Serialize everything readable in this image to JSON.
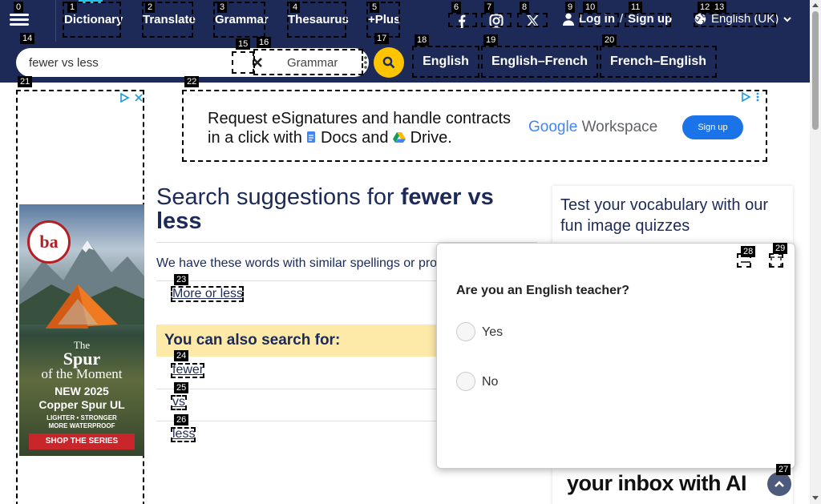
{
  "nav": {
    "items": [
      "Dictionary",
      "Translate",
      "Grammar",
      "Thesaurus",
      "+Plus"
    ],
    "login": "Log in",
    "slash": "/",
    "signup": "Sign up",
    "language": "English (UK)"
  },
  "search": {
    "value": "fewer vs less",
    "dictionary": "Grammar",
    "tabs": [
      "English",
      "English–French",
      "French–English"
    ]
  },
  "ads": {
    "top_line1": "Request eSignatures and handle contracts",
    "top_line2_a": "in a click with",
    "top_line2_docs": "Docs",
    "top_line2_and": "and",
    "top_line2_drive": "Drive.",
    "top_brand_g": "Google",
    "top_brand_w": "Workspace",
    "top_signup": "Sign up",
    "side_logo": "ba",
    "side_the": "The",
    "side_spur": "Spur",
    "side_moment": "of the Moment",
    "side_new": "NEW 2025",
    "side_product": "Copper Spur UL",
    "side_features1": "LIGHTER • STRONGER",
    "side_features2": "MORE WATERPROOF",
    "side_cta": "SHOP THE SERIES"
  },
  "main": {
    "heading_prefix": "Search suggestions for",
    "heading_term": "fewer vs less",
    "subtitle": "We have these words with similar spellings or pro",
    "suggestions": [
      "More or less"
    ],
    "also_title": "You can also search for:",
    "also_links": [
      "fewer",
      "vs",
      "less"
    ]
  },
  "quiz": {
    "title": "Test your vocabulary with our fun image quizzes",
    "ad_text": "your inbox with AI"
  },
  "popup": {
    "question": "Are you an English teacher?",
    "options": [
      "Yes",
      "No"
    ]
  },
  "markers": [
    "0",
    "1",
    "2",
    "3",
    "4",
    "5",
    "6",
    "7",
    "8",
    "9",
    "10",
    "11",
    "12",
    "13",
    "14",
    "15",
    "16",
    "17",
    "18",
    "19",
    "20",
    "21",
    "22",
    "23",
    "24",
    "25",
    "26",
    "27",
    "28",
    "29"
  ],
  "colors": {
    "nav_bg": "#1d2a57",
    "accent": "#fec400",
    "highlight": "#fde9a8",
    "cyan": "#24c4e8"
  }
}
